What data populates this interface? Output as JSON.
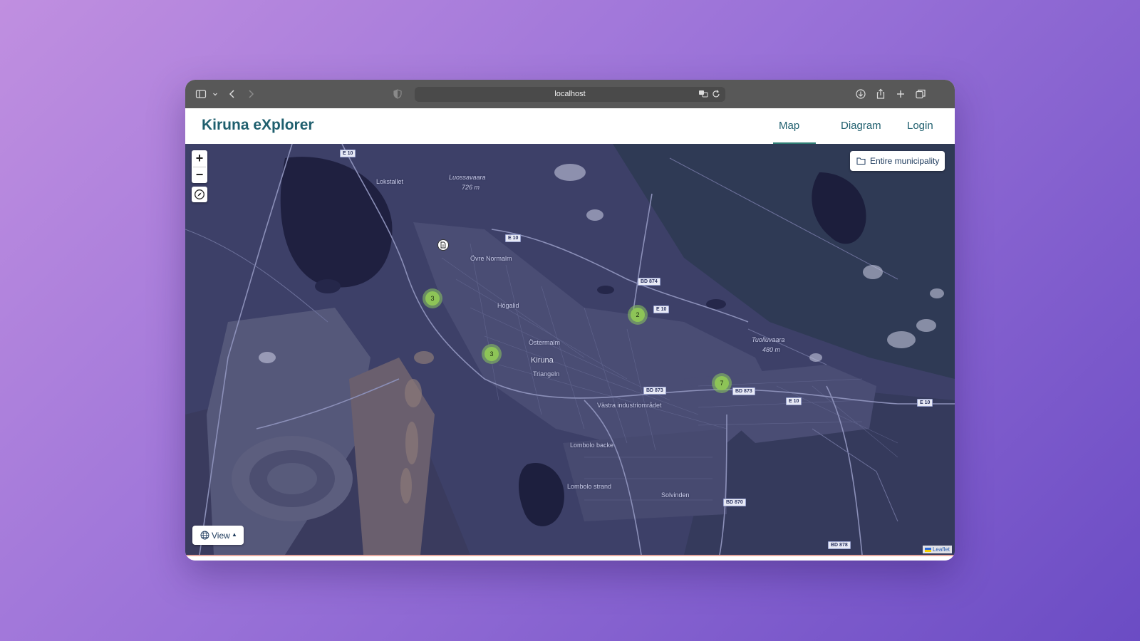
{
  "browser": {
    "url": "localhost"
  },
  "navbar": {
    "brand": "Kiruna eXplorer",
    "links": [
      {
        "label": "Map"
      },
      {
        "label": "Diagram"
      },
      {
        "label": "Login"
      }
    ]
  },
  "map": {
    "controls": {
      "zoom_in": "+",
      "zoom_out": "−",
      "municipality_button": "Entire municipality",
      "view_button": "View"
    },
    "clusters": [
      {
        "count": "3"
      },
      {
        "count": "3"
      },
      {
        "count": "2"
      },
      {
        "count": "7"
      }
    ],
    "labels": {
      "luossavaara": "Luossavaara",
      "luossavaara_elev": "726 m",
      "lokstallet": "Lokstallet",
      "ovre_normalm": "Övre Normalm",
      "hogalid": "Högalid",
      "ostermalm": "Östermalm",
      "kiruna": "Kiruna",
      "triangeln": "Triangeln",
      "vastra": "Västra industriområdet",
      "tuolluvaara": "Tuolluvaara",
      "tuolluvaara_elev": "480 m",
      "lombolo_backe": "Lombolo backe",
      "lombolo_strand": "Lombolo strand",
      "solvinden": "Solvinden"
    },
    "roads": {
      "e10_a": "E 10",
      "e10_b": "E 10",
      "e10_c": "E 10",
      "e10_d": "E 10",
      "e10_e": "E 10",
      "bd874": "BD 874",
      "bd873_a": "BD 873",
      "bd873_b": "BD 873",
      "bd870": "BD 870",
      "bd878": "BD 878"
    },
    "attribution": "Leaflet"
  }
}
